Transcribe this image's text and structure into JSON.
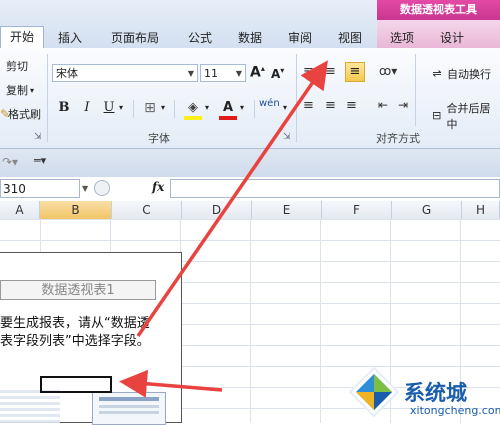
{
  "tabs": {
    "context_group": "数据透视表工具",
    "items": [
      "开始",
      "插入",
      "页面布局",
      "公式",
      "数据",
      "审阅",
      "视图",
      "选项",
      "设计"
    ]
  },
  "clipboard": {
    "cut": "剪切",
    "copy": "复制",
    "format_painter": "格式刷"
  },
  "font": {
    "name": "宋体",
    "size": "11",
    "group_label": "字体",
    "grow": "A",
    "shrink": "A",
    "bold": "B",
    "italic": "I",
    "underline": "U",
    "font_color": "A",
    "phonetic": "wén"
  },
  "alignment": {
    "group_label": "对齐方式",
    "wrap_text": "自动换行",
    "merge_center": "合并后居中"
  },
  "formula_bar": {
    "name_box": "310",
    "fx": "fx"
  },
  "columns": [
    "A",
    "B",
    "C",
    "D",
    "E",
    "F",
    "G",
    "H"
  ],
  "pivot": {
    "title": "数据透视表1",
    "line1": "要生成报表，请从“数据透",
    "line2": "表字段列表”中选择字段。"
  },
  "watermark": {
    "text": "系统城",
    "url": "xitongcheng.com"
  },
  "colors": {
    "accent_context": "#c8358f",
    "arrow": "#e8433f",
    "selected_col": "#f1c466",
    "watermark": "#1a5dad"
  }
}
